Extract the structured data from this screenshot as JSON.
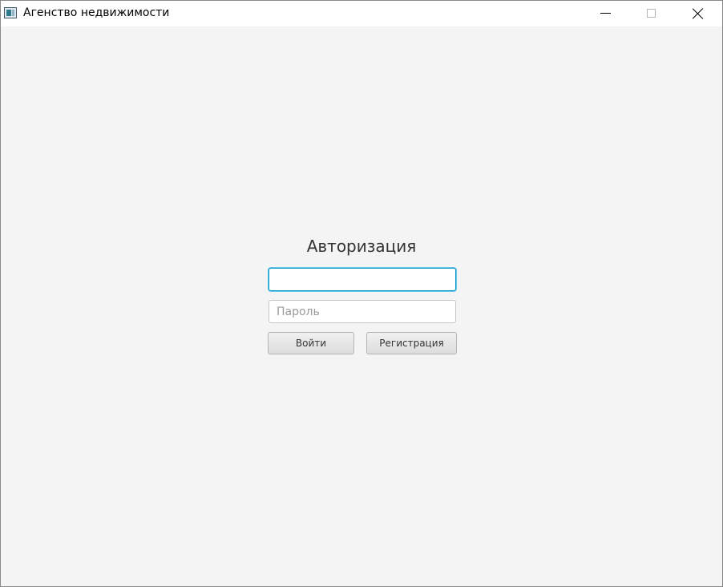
{
  "window": {
    "title": "Агенство недвижимости",
    "icon": "app-window-icon"
  },
  "window_controls": {
    "minimize_icon": "minimize-icon",
    "maximize_icon": "maximize-icon",
    "close_icon": "close-icon"
  },
  "auth": {
    "heading": "Авторизация",
    "login_value": "",
    "login_placeholder": "",
    "password_value": "",
    "password_placeholder": "Пароль",
    "login_button": "Войти",
    "register_button": "Регистрация"
  },
  "colors": {
    "background": "#f4f4f4",
    "focus_border": "#0096c9",
    "button_border": "#b5b5b5"
  }
}
